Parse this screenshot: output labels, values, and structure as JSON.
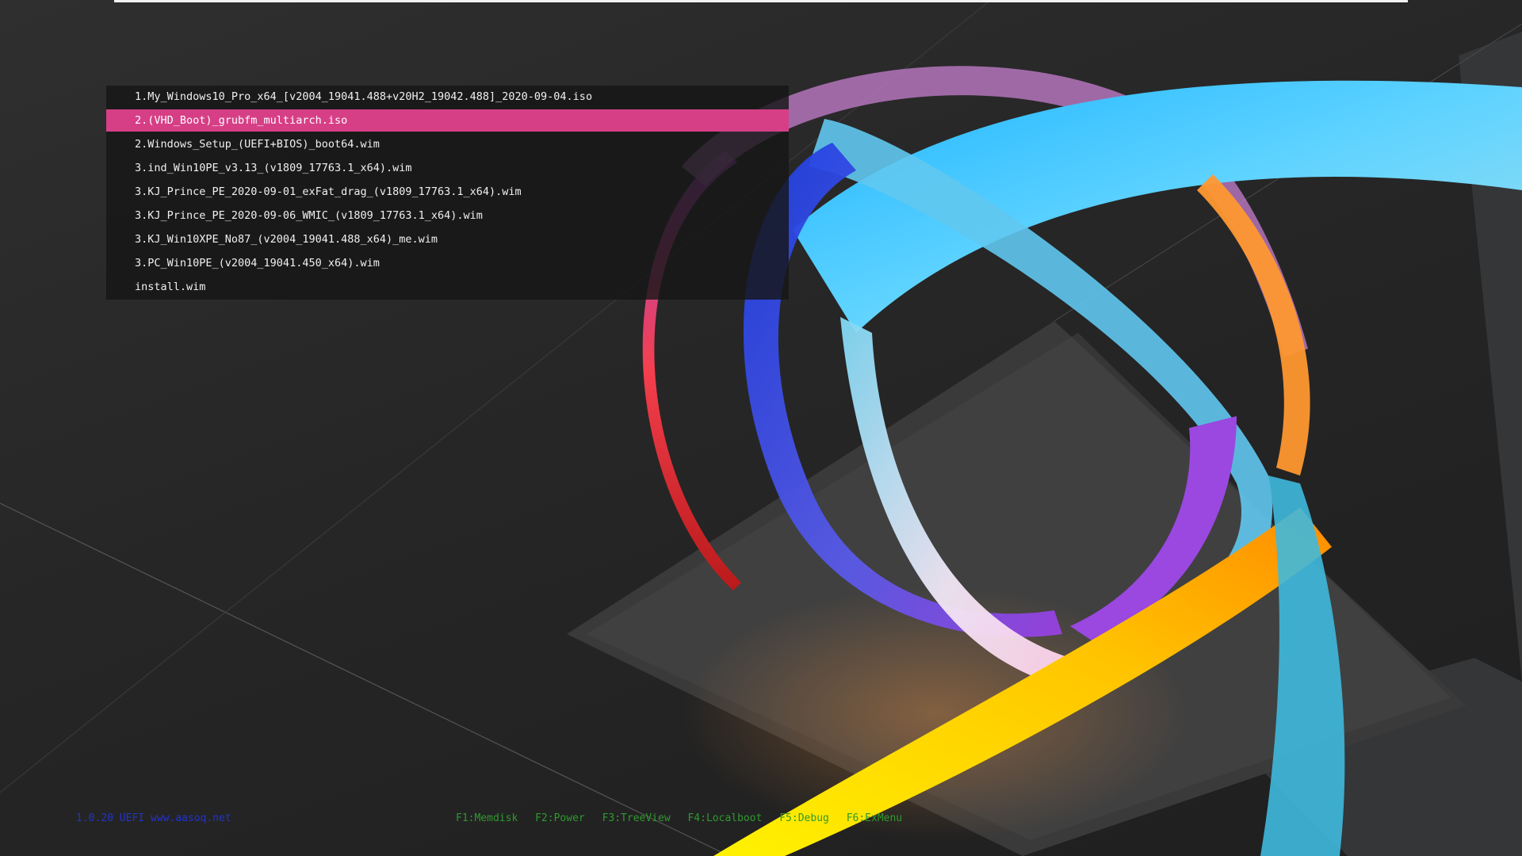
{
  "menu": {
    "selected_index": 1,
    "items": [
      {
        "label": "1.My_Windows10_Pro_x64_[v2004_19041.488+v20H2_19042.488]_2020-09-04.iso"
      },
      {
        "label": "2.(VHD_Boot)_grubfm_multiarch.iso"
      },
      {
        "label": "2.Windows_Setup_(UEFI+BIOS)_boot64.wim"
      },
      {
        "label": "3.ind_Win10PE_v3.13_(v1809_17763.1_x64).wim"
      },
      {
        "label": "3.KJ_Prince_PE_2020-09-01_exFat_drag_(v1809_17763.1_x64).wim"
      },
      {
        "label": "3.KJ_Prince_PE_2020-09-06_WMIC_(v1809_17763.1_x64).wim"
      },
      {
        "label": "3.KJ_Win10XPE_No87_(v2004_19041.488_x64)_me.wim"
      },
      {
        "label": "3.PC_Win10PE_(v2004_19041.450_x64).wim"
      },
      {
        "label": "install.wim"
      }
    ]
  },
  "status": {
    "left_text": "1.0.20 UEFI  www.aasoq.net"
  },
  "hotkeys": [
    {
      "label": "F1:Memdisk"
    },
    {
      "label": "F2:Power"
    },
    {
      "label": "F3:TreeView"
    },
    {
      "label": "F4:Localboot"
    },
    {
      "label": "F5:Debug"
    },
    {
      "label": "F6:ExMenu"
    }
  ],
  "colors": {
    "selection": "#d63f86",
    "hotkey_text": "#2e9a2e",
    "status_text": "#2233cc",
    "menu_bg": "#161616"
  }
}
